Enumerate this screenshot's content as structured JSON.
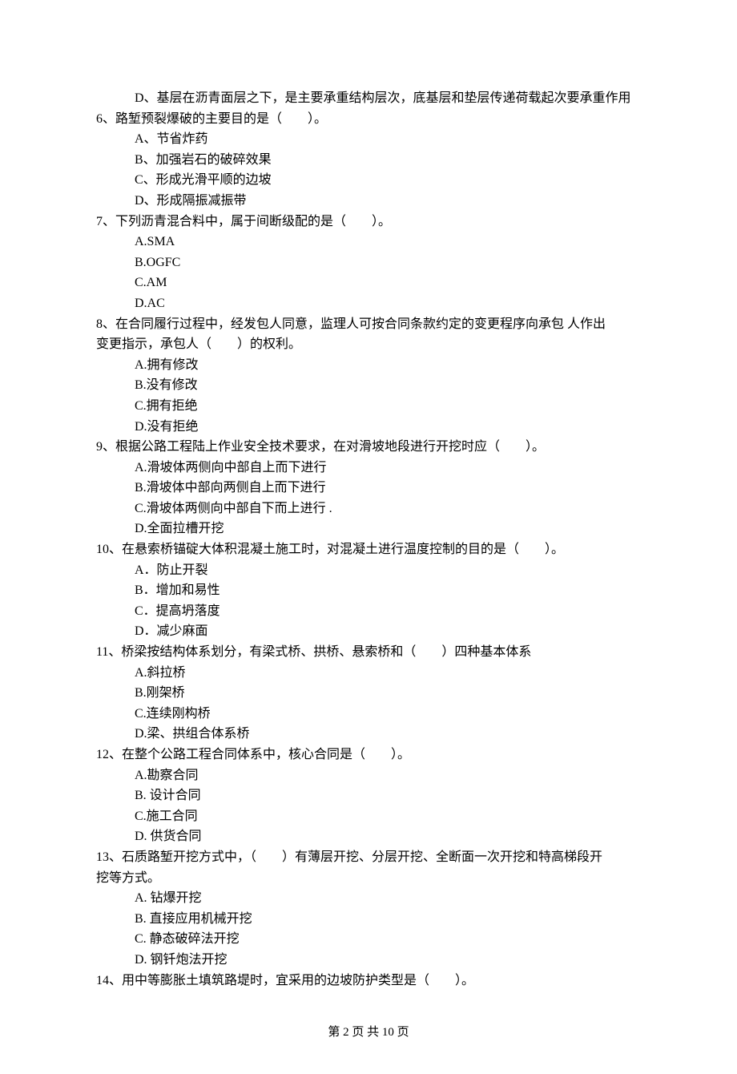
{
  "leadingOption": "D、基层在沥青面层之下，是主要承重结构层次，底基层和垫层传递荷载起次要承重作用",
  "questions": [
    {
      "number": "6",
      "stemLines": [
        "路堑预裂爆破的主要目的是（　　）。"
      ],
      "options": [
        "A、节省炸药",
        "B、加强岩石的破碎效果",
        "C、形成光滑平顺的边坡",
        "D、形成隔振减振带"
      ]
    },
    {
      "number": "7",
      "stemLines": [
        "下列沥青混合料中，属于间断级配的是（　　）。"
      ],
      "options": [
        "A.SMA",
        "B.OGFC",
        "C.AM",
        "D.AC"
      ]
    },
    {
      "number": "8",
      "stemLines": [
        "在合同履行过程中，经发包人同意，监理人可按合同条款约定的变更程序向承包 人作出",
        "变更指示，承包人（　　）的权利。"
      ],
      "options": [
        "A.拥有修改",
        "B.没有修改",
        "C.拥有拒绝",
        "D.没有拒绝"
      ]
    },
    {
      "number": "9",
      "stemLines": [
        "根据公路工程陆上作业安全技术要求，在对滑坡地段进行开挖时应（　　）。"
      ],
      "options": [
        "A.滑坡体两侧向中部自上而下进行",
        "B.滑坡体中部向两侧自上而下进行",
        "C.滑坡体两侧向中部自下而上进行 .",
        "D.全面拉槽开挖"
      ]
    },
    {
      "number": "10",
      "stemLines": [
        "在悬索桥锚碇大体积混凝土施工时，对混凝土进行温度控制的目的是（　　）。"
      ],
      "options": [
        "A．防止开裂",
        "B．增加和易性",
        "C．提高坍落度",
        "D．减少麻面"
      ]
    },
    {
      "number": "11",
      "stemLines": [
        "桥梁按结构体系划分，有梁式桥、拱桥、悬索桥和（　　）四种基本体系"
      ],
      "options": [
        "A.斜拉桥",
        "B.刚架桥",
        "C.连续刚构桥",
        "D.梁、拱组合体系桥"
      ]
    },
    {
      "number": "12",
      "stemLines": [
        "在整个公路工程合同体系中，核心合同是（　　）。"
      ],
      "options": [
        "A.勘察合同",
        "B. 设计合同",
        "C.施工合同",
        "D. 供货合同"
      ]
    },
    {
      "number": "13",
      "stemLines": [
        "石质路堑开挖方式中，（　　）有薄层开挖、分层开挖、全断面一次开挖和特高梯段开",
        "挖等方式。"
      ],
      "options": [
        "A. 钻爆开挖",
        "B. 直接应用机械开挖",
        "C. 静态破碎法开挖",
        "D. 钢钎炮法开挖"
      ]
    },
    {
      "number": "14",
      "stemLines": [
        "用中等膨胀土填筑路堤时，宜采用的边坡防护类型是（　　）。"
      ],
      "options": []
    }
  ],
  "separators": {
    "afterNumber": "、"
  },
  "footer": "第 2 页 共 10 页"
}
